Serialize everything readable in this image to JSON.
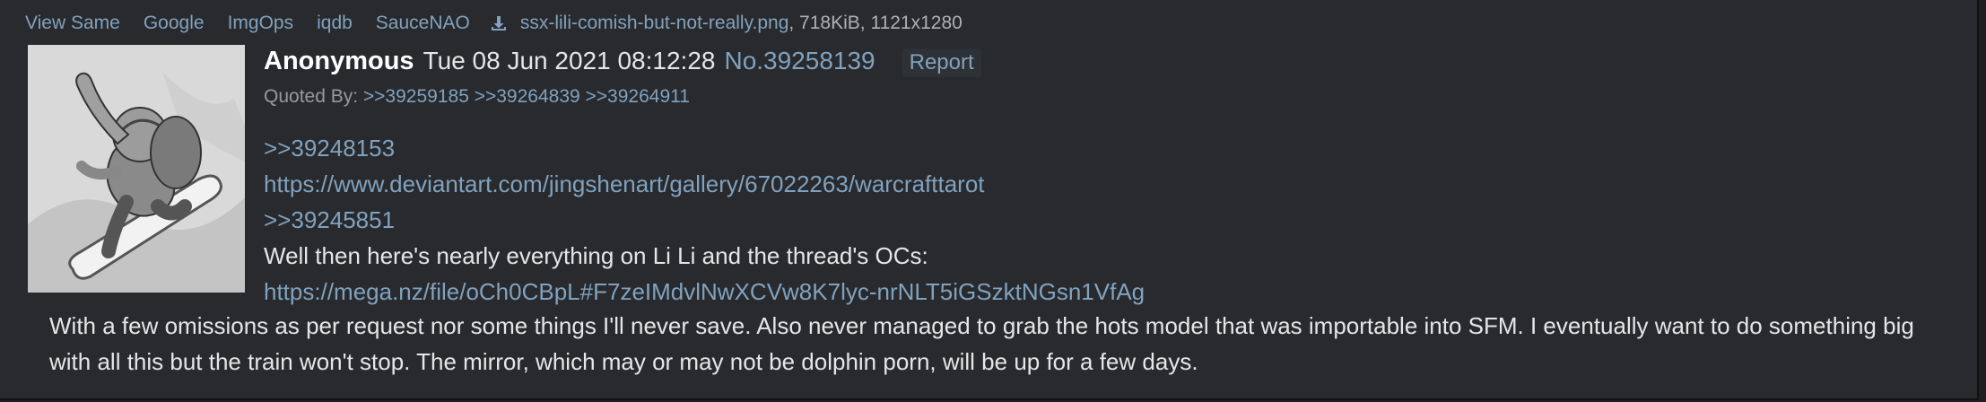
{
  "file_info": {
    "buttons": [
      "View Same",
      "Google",
      "ImgOps",
      "iqdb",
      "SauceNAO"
    ],
    "download_icon": "download-icon",
    "filename": "ssx-lili-comish-but-not-really.png",
    "meta": ", 718KiB, 1121x1280"
  },
  "thumbnail": {
    "description_icon": "thumbnail-image"
  },
  "post": {
    "name": "Anonymous",
    "date": "Tue 08 Jun 2021 08:12:28",
    "number": "No.39258139",
    "report_label": "Report",
    "quoted_by_label": "Quoted By:",
    "quoted_by": [
      ">>39259185",
      ">>39264839",
      ">>39264911"
    ],
    "lines": [
      {
        "type": "link",
        "text": ">>39248153"
      },
      {
        "type": "link",
        "text": "https://www.deviantart.com/jingshenart/gallery/67022263/warcrafttarot"
      },
      {
        "type": "link",
        "text": ">>39245851"
      },
      {
        "type": "text",
        "text": "Well then here's nearly everything on Li Li and the thread's OCs:"
      },
      {
        "type": "link",
        "text": "https://mega.nz/file/oCh0CBpL#F7zeIMdvlNwXCVw8K7lyc-nrNLT5iGSzktNGsn1VfAg"
      }
    ],
    "paragraph": "With a few omissions as per request nor some things I'll never save. Also never managed to grab the hots model that was importable into SFM. I eventually want to do something big with all this but the train won't stop. The mirror, which may or may not be dolphin porn, will be up for a few days."
  },
  "colors": {
    "background": "#282a2e",
    "link": "#81a2be",
    "text": "#e6e6e6",
    "muted": "#aaaaaa"
  }
}
